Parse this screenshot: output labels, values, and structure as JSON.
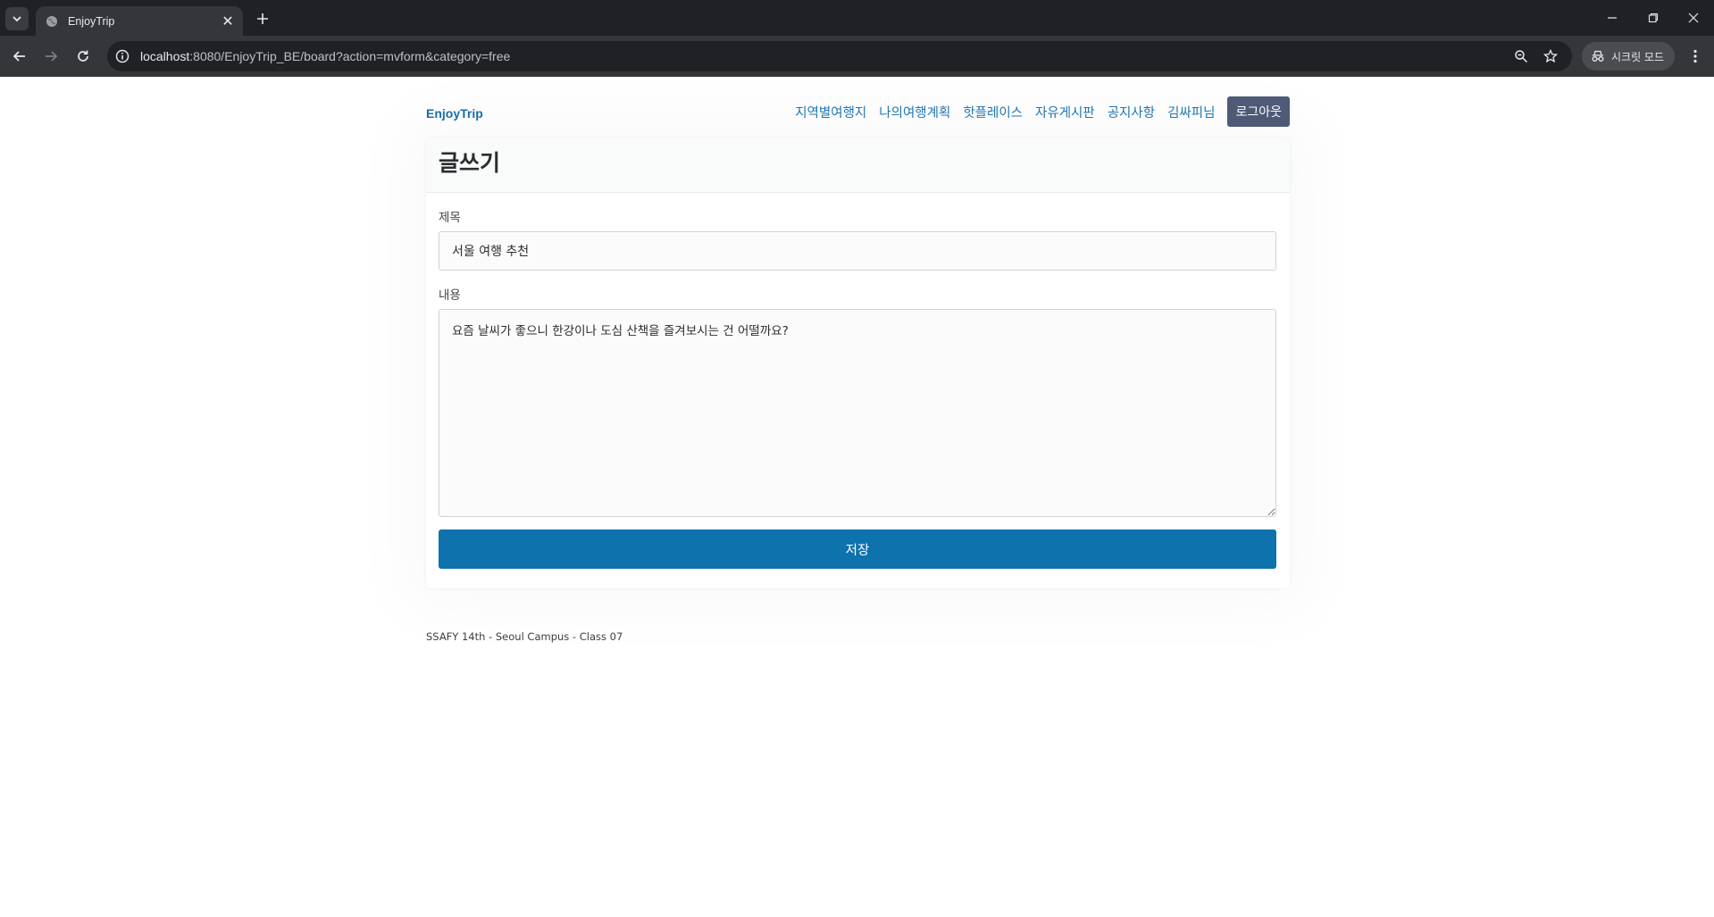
{
  "browser": {
    "tab_title": "EnjoyTrip",
    "url_host": "localhost",
    "url_rest": ":8080/EnjoyTrip_BE/board?action=mvform&category=free",
    "incognito_label": "시크릿 모드"
  },
  "nav": {
    "brand": "EnjoyTrip",
    "links": [
      "지역별여행지",
      "나의여행계획",
      "핫플레이스",
      "자유게시판",
      "공지사항",
      "김싸피님"
    ],
    "logout": "로그아웃"
  },
  "form": {
    "heading": "글쓰기",
    "title_label": "제목",
    "title_value": "서울 여행 추천",
    "content_label": "내용",
    "content_value": "요즘 날씨가 좋으니 한강이나 도심 산책을 즐겨보시는 건 어떨까요?",
    "save_label": "저장"
  },
  "footer": {
    "text": "SSAFY 14th - Seoul Campus - Class 07"
  },
  "colors": {
    "accent": "#0e72ad",
    "nav_link": "#1f78b4",
    "logout_bg": "#4f5b77"
  }
}
